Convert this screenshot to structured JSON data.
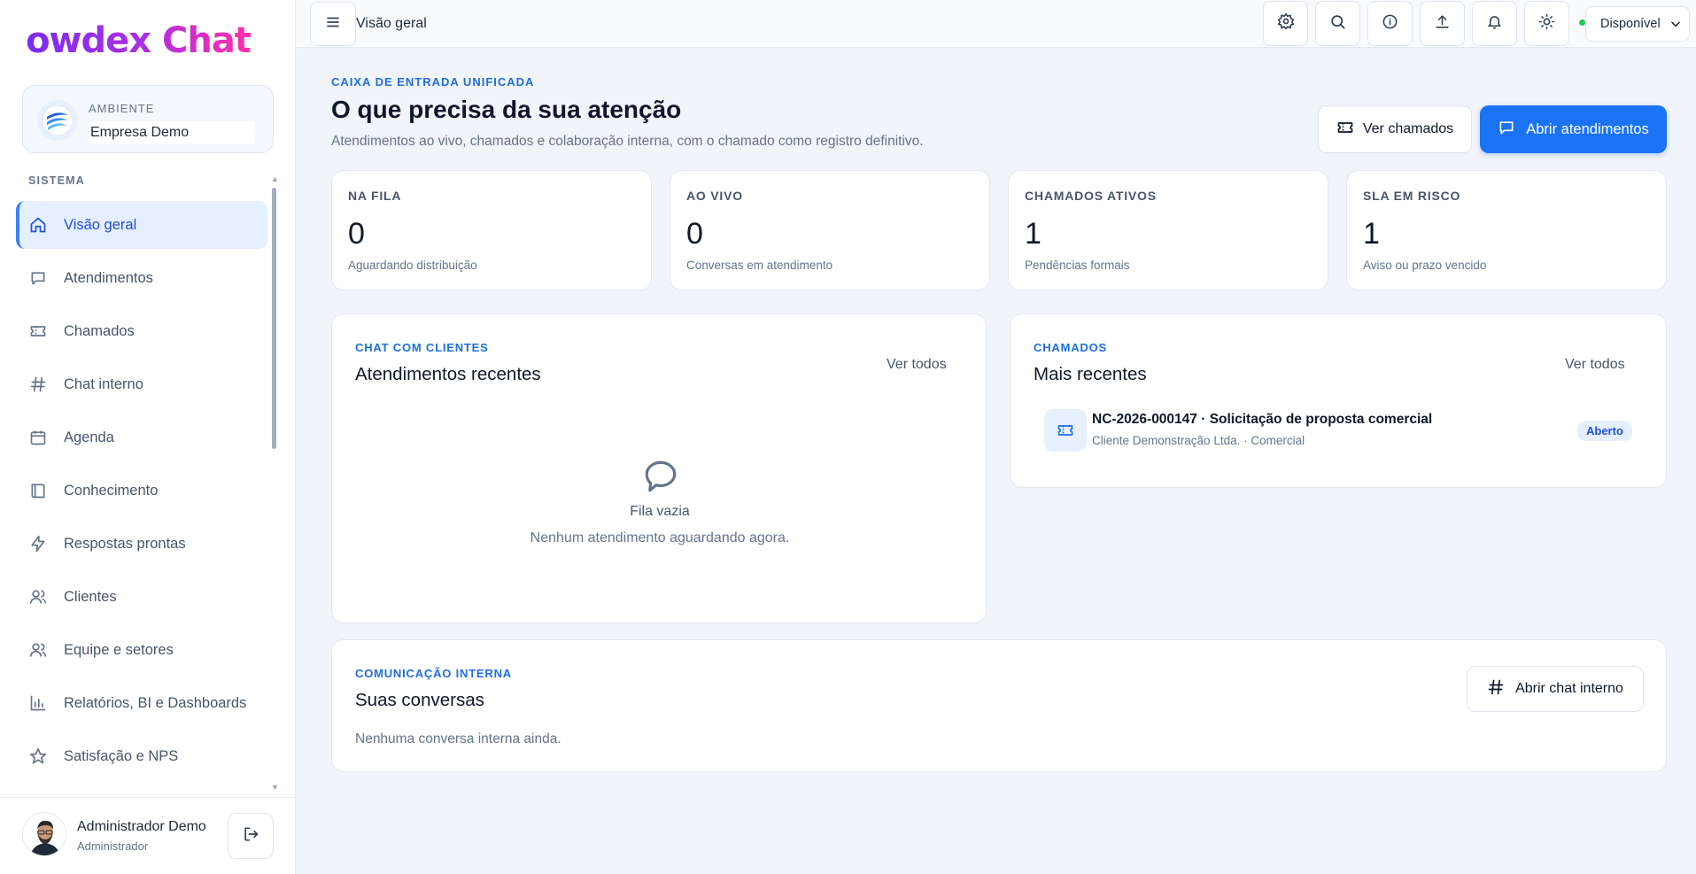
{
  "brand": {
    "logo_text": "owdex Chat"
  },
  "environment": {
    "label": "AMBIENTE",
    "name": "Empresa Demo"
  },
  "sidebar": {
    "section_label": "SISTEMA",
    "items": [
      {
        "label": "Visão geral",
        "icon": "home-icon",
        "active": true
      },
      {
        "label": "Atendimentos",
        "icon": "chat-bubble-icon"
      },
      {
        "label": "Chamados",
        "icon": "ticket-icon"
      },
      {
        "label": "Chat interno",
        "icon": "hash-icon"
      },
      {
        "label": "Agenda",
        "icon": "calendar-icon"
      },
      {
        "label": "Conhecimento",
        "icon": "book-icon"
      },
      {
        "label": "Respostas prontas",
        "icon": "lightning-icon"
      },
      {
        "label": "Clientes",
        "icon": "users-icon"
      },
      {
        "label": "Equipe e setores",
        "icon": "team-icon"
      },
      {
        "label": "Relatórios, BI e Dashboards",
        "icon": "bar-chart-icon"
      },
      {
        "label": "Satisfação e NPS",
        "icon": "star-icon"
      }
    ]
  },
  "user": {
    "name": "Administrador Demo",
    "role": "Administrador"
  },
  "header": {
    "title": "Visão geral",
    "status": "Disponível",
    "icons": [
      "settings-icon",
      "search-icon",
      "info-icon",
      "upload-icon",
      "bell-icon",
      "sun-icon"
    ]
  },
  "main": {
    "kicker": "CAIXA DE ENTRADA UNIFICADA",
    "title": "O que precisa da sua atenção",
    "subtitle": "Atendimentos ao vivo, chamados e colaboração interna, com o chamado como registro definitivo.",
    "btn_tickets": "Ver chamados",
    "btn_open": "Abrir atendimentos"
  },
  "stats": [
    {
      "label": "NA FILA",
      "value": "0",
      "desc": "Aguardando distribuição"
    },
    {
      "label": "AO VIVO",
      "value": "0",
      "desc": "Conversas em atendimento"
    },
    {
      "label": "CHAMADOS ATIVOS",
      "value": "1",
      "desc": "Pendências formais"
    },
    {
      "label": "SLA EM RISCO",
      "value": "1",
      "desc": "Aviso ou prazo vencido"
    }
  ],
  "chat_card": {
    "kicker": "CHAT COM CLIENTES",
    "title": "Atendimentos recentes",
    "see_all": "Ver todos",
    "empty_title": "Fila vazia",
    "empty_desc": "Nenhum atendimento aguardando agora."
  },
  "tickets_card": {
    "kicker": "CHAMADOS",
    "title": "Mais recentes",
    "see_all": "Ver todos",
    "items": [
      {
        "title": "NC-2026-000147 · Solicitação de proposta comercial",
        "subtitle": "Cliente Demonstração Ltda. · Comercial",
        "status": "Aberto"
      }
    ]
  },
  "internal_card": {
    "kicker": "COMUNICAÇÃO INTERNA",
    "title": "Suas conversas",
    "btn": "Abrir chat interno",
    "empty": "Nenhuma conversa interna ainda."
  },
  "colors": {
    "accent": "#1a73f5",
    "active_bg": "#e5efff",
    "status_dot": "#22c55e"
  }
}
